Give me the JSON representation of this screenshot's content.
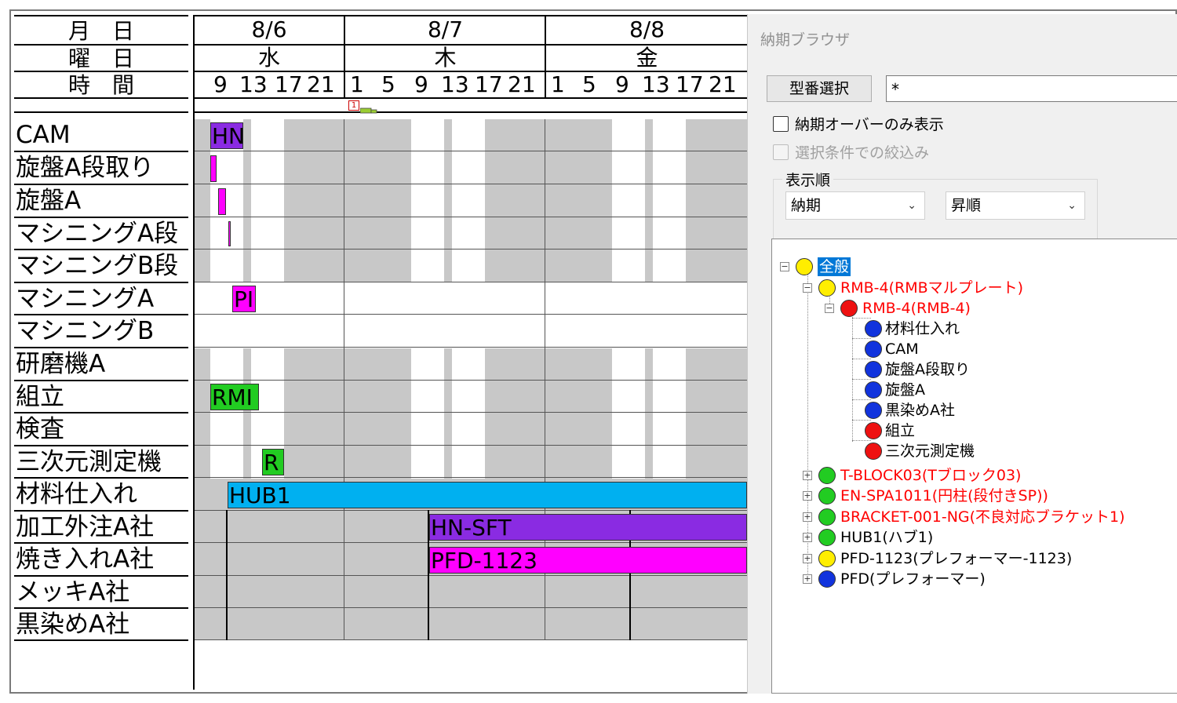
{
  "gantt": {
    "header_labels": {
      "month_day": "月　日",
      "weekday": "曜　日",
      "hours": "時　間"
    },
    "dates": [
      {
        "date": "8/6",
        "weekday": "水",
        "hours": [
          "9",
          "13",
          "17",
          "21"
        ]
      },
      {
        "date": "8/7",
        "weekday": "木",
        "hours": [
          "1",
          "5",
          "9",
          "13",
          "17",
          "21"
        ]
      },
      {
        "date": "8/8",
        "weekday": "金",
        "hours": [
          "1",
          "5",
          "9",
          "13",
          "17",
          "21"
        ]
      }
    ],
    "resources": [
      "CAM",
      "旋盤A段取り",
      "旋盤A",
      "マシニングA段",
      "マシニングB段",
      "マシニングA",
      "マシニングB",
      "研磨機A",
      "組立",
      "検査",
      "三次元測定機",
      "材料仕入れ",
      "加工外注A社",
      "焼き入れA社",
      "メッキA社",
      "黒染めA社"
    ],
    "bars": [
      {
        "label": "HN",
        "color": "#8a2be2"
      },
      {
        "label": "",
        "color": "#ff00ff"
      },
      {
        "label": "",
        "color": "#ff00ff"
      },
      {
        "label": "",
        "color": "#ff00ff"
      },
      {
        "label": "PI",
        "color": "#ff00ff"
      },
      {
        "label": "RMI",
        "color": "#22cc22"
      },
      {
        "label": "R",
        "color": "#22cc22"
      },
      {
        "label": "HUB1",
        "color": "#00b0f0"
      },
      {
        "label": "HN-SFT",
        "color": "#8a2be2"
      },
      {
        "label": "PFD-1123",
        "color": "#ff00ff"
      }
    ],
    "marker": "1"
  },
  "panel": {
    "title": "納期ブラウザ",
    "model_button": "型番選択",
    "model_input_value": "*",
    "checkbox_overdue": "納期オーバーのみ表示",
    "checkbox_filter": "選択条件での絞込み",
    "sort_group": "表示順",
    "sort_field": "納期",
    "sort_order": "昇順"
  },
  "tree": {
    "root": {
      "label": "全般",
      "color": "#ffee00"
    },
    "nodes": [
      {
        "label": "RMB-4(RMBマルプレート)",
        "color": "#ffee00",
        "text_color": "#ff0000"
      },
      {
        "label": "RMB-4(RMB-4)",
        "color": "#ee1111",
        "text_color": "#ff0000"
      },
      {
        "label": "材料仕入れ",
        "color": "#1133dd",
        "text_color": "#000000"
      },
      {
        "label": "CAM",
        "color": "#1133dd",
        "text_color": "#000000"
      },
      {
        "label": "旋盤A段取り",
        "color": "#1133dd",
        "text_color": "#000000"
      },
      {
        "label": "旋盤A",
        "color": "#1133dd",
        "text_color": "#000000"
      },
      {
        "label": "黒染めA社",
        "color": "#1133dd",
        "text_color": "#000000"
      },
      {
        "label": "組立",
        "color": "#ee1111",
        "text_color": "#000000"
      },
      {
        "label": "三次元測定機",
        "color": "#ee1111",
        "text_color": "#000000"
      },
      {
        "label": "T-BLOCK03(Tブロック03)",
        "color": "#22cc22",
        "text_color": "#ff0000"
      },
      {
        "label": "EN-SPA1011(円柱(段付きSP))",
        "color": "#22cc22",
        "text_color": "#ff0000"
      },
      {
        "label": "BRACKET-001-NG(不良対応ブラケット1)",
        "color": "#22cc22",
        "text_color": "#ff0000"
      },
      {
        "label": "HUB1(ハブ1)",
        "color": "#22cc22",
        "text_color": "#000000"
      },
      {
        "label": "PFD-1123(プレフォーマー-1123)",
        "color": "#ffee00",
        "text_color": "#000000"
      },
      {
        "label": "PFD(プレフォーマー)",
        "color": "#1133dd",
        "text_color": "#000000"
      }
    ]
  }
}
